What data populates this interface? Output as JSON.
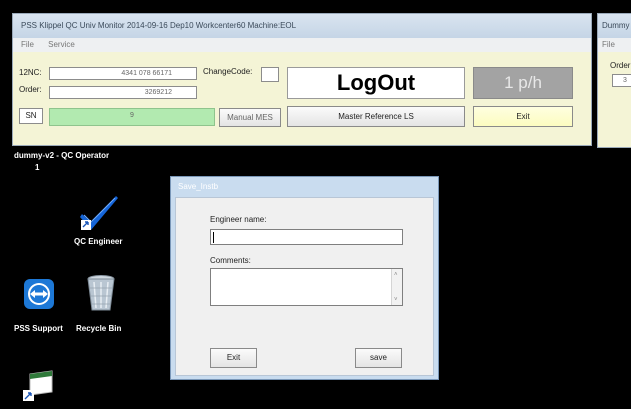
{
  "main_window": {
    "title": "PSS Klippel QC Univ Monitor  2014-09-16  Dep10  Workcenter60  Machine:EOL",
    "menu": [
      "File",
      "Service"
    ],
    "fields": {
      "nc_label": "12NC:",
      "nc_value": "4341 078 66171",
      "order_label": "Order:",
      "order_value": "3269212",
      "sn_label": "SN",
      "sn_value": "9",
      "changecode_label": "ChangeCode:"
    },
    "buttons": {
      "manual_mes": "Manual MES",
      "master_reference": "Master Reference LS",
      "exit": "Exit"
    },
    "logout_text": "LogOut",
    "rate_text": "1 p/h"
  },
  "right_window": {
    "title": "Dummy",
    "menu": "File",
    "order_label": "Order",
    "order_value": "3"
  },
  "desktop": {
    "user_label": "dummy-v2 -  QC Operator",
    "user_number": "1",
    "icons": [
      {
        "label": "QC Engineer",
        "icon": "checkmark-shortcut-icon"
      },
      {
        "label": "PSS Support",
        "icon": "teamviewer-icon"
      },
      {
        "label": "Recycle Bin",
        "icon": "recycle-bin-icon"
      },
      {
        "label": "",
        "icon": "shortcut-icon"
      }
    ]
  },
  "dialog": {
    "title": "Save_Instb",
    "engineer_label": "Engineer name:",
    "engineer_value": "",
    "comments_label": "Comments:",
    "comments_value": "",
    "exit_label": "Exit",
    "save_label": "save"
  },
  "colors": {
    "panel_bg": "#f4f4d6",
    "sn_field_bg": "#b2eab0",
    "button_highlight": "#fcfcc0",
    "rate_bg": "#a3a3a3",
    "dialog_frame": "#c9dcef",
    "checkmark_blue": "#1565d8"
  }
}
